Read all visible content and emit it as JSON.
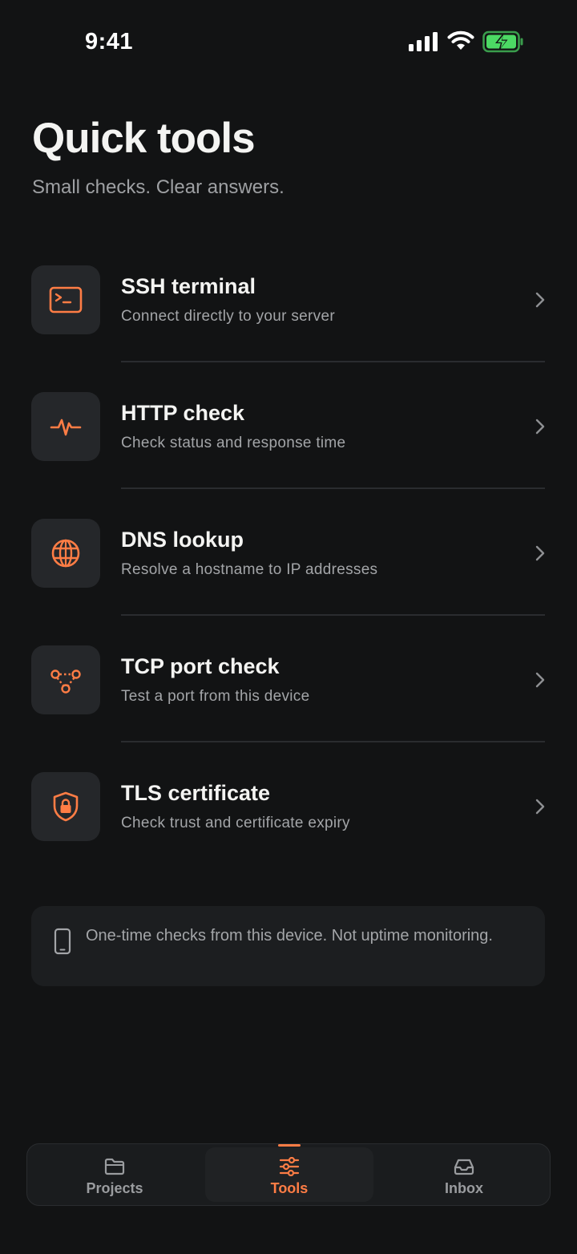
{
  "status_bar": {
    "time": "9:41"
  },
  "header": {
    "title": "Quick tools",
    "subtitle": "Small checks. Clear answers."
  },
  "tools": [
    {
      "title": "SSH terminal",
      "description": "Connect directly to your server",
      "icon": "terminal-icon"
    },
    {
      "title": "HTTP check",
      "description": "Check status and response time",
      "icon": "pulse-icon"
    },
    {
      "title": "DNS lookup",
      "description": "Resolve a hostname to IP addresses",
      "icon": "globe-icon"
    },
    {
      "title": "TCP port check",
      "description": "Test a port from this device",
      "icon": "network-nodes-icon"
    },
    {
      "title": "TLS certificate",
      "description": "Check trust and certificate expiry",
      "icon": "lock-shield-icon"
    }
  ],
  "info": {
    "text": "One-time checks from this device. Not uptime monitoring.",
    "icon": "phone-icon"
  },
  "tab_bar": {
    "active": "Tools",
    "tabs": [
      {
        "label": "Projects",
        "icon": "folder-icon"
      },
      {
        "label": "Tools",
        "icon": "sliders-icon"
      },
      {
        "label": "Inbox",
        "icon": "inbox-icon"
      }
    ]
  },
  "colors": {
    "accent": "#ff7d45",
    "background": "#121314",
    "card": "#25272a",
    "battery": "#4cd964"
  }
}
